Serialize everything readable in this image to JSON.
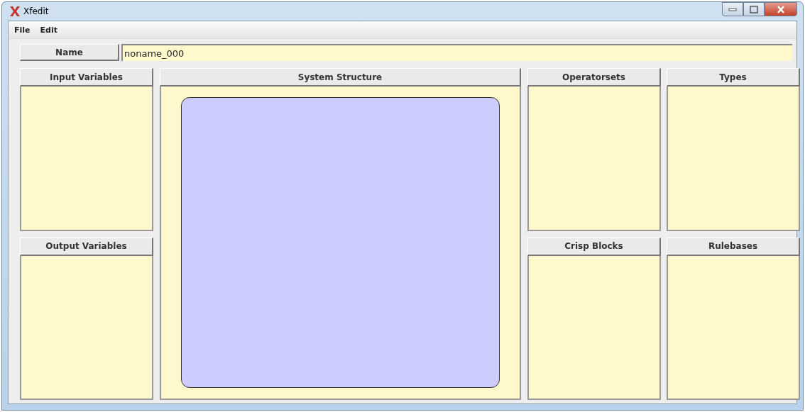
{
  "window": {
    "title": "Xfedit"
  },
  "menu": [
    "File",
    "Edit"
  ],
  "name_field": {
    "label": "Name",
    "value": "noname_000"
  },
  "left_panels": [
    {
      "title": "Input Variables"
    },
    {
      "title": "Output Variables"
    }
  ],
  "system_structure": {
    "title": "System Structure"
  },
  "right_panels": [
    {
      "title": "Operatorsets"
    },
    {
      "title": "Types"
    },
    {
      "title": "Crisp Blocks"
    },
    {
      "title": "Rulebases"
    }
  ]
}
